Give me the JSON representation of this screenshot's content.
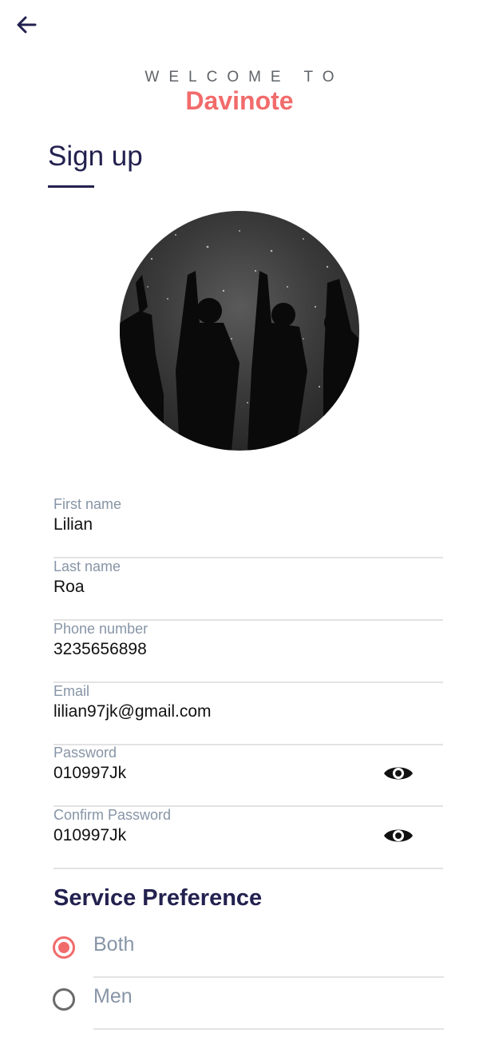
{
  "header": {
    "back_icon": "arrow-left-icon",
    "welcome_text": "WELCOME TO",
    "brand_name": "Davinote",
    "page_title": "Sign up"
  },
  "avatar": {
    "description": "profile-photo"
  },
  "form": {
    "fields": [
      {
        "label": "First name",
        "value": "Lilian"
      },
      {
        "label": "Last name",
        "value": "Roa"
      },
      {
        "label": "Phone number",
        "value": "3235656898"
      },
      {
        "label": "Email",
        "value": "lilian97jk@gmail.com"
      },
      {
        "label": "Password",
        "value": "010997Jk",
        "icon": "eye-icon"
      },
      {
        "label": "Confirm Password",
        "value": "010997Jk",
        "icon": "eye-icon"
      }
    ]
  },
  "service_preference": {
    "title": "Service Preference",
    "options": [
      {
        "label": "Both",
        "selected": true
      },
      {
        "label": "Men",
        "selected": false
      }
    ]
  },
  "colors": {
    "accent": "#f26b6b",
    "heading": "#22214f",
    "label": "#8795a6",
    "divider": "#e3e3e3"
  }
}
